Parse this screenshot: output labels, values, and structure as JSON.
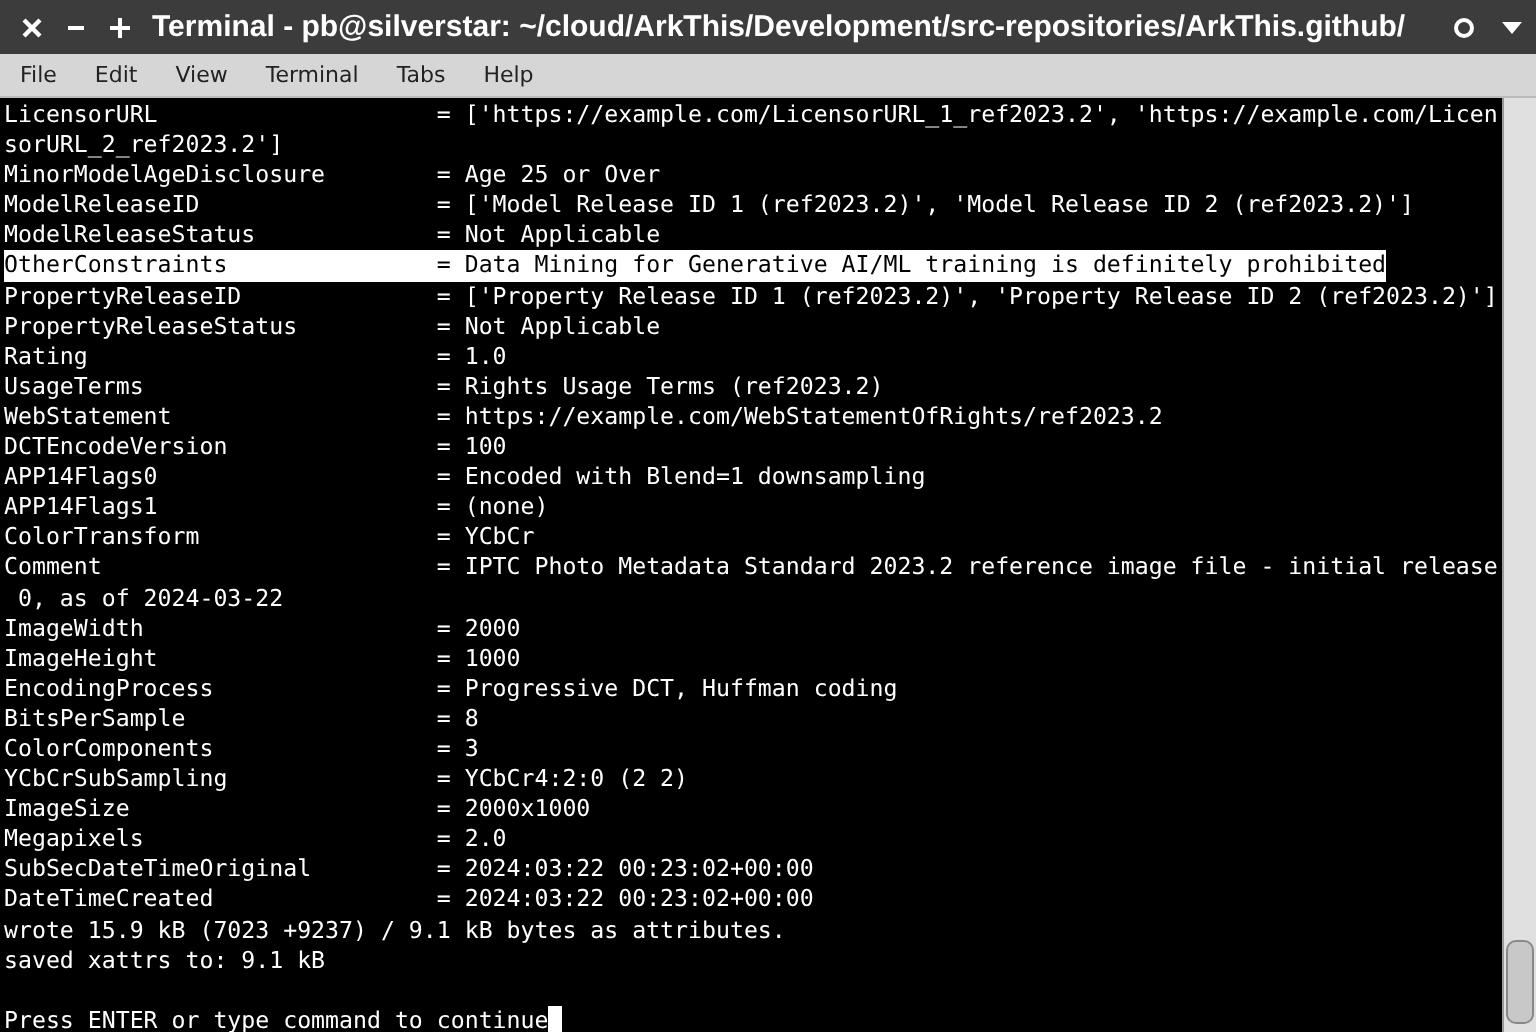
{
  "window": {
    "title": "Terminal - pb@silverstar: ~/cloud/ArkThis/Development/src-repositories/ArkThis.github/"
  },
  "menu": [
    {
      "label": "File"
    },
    {
      "label": "Edit"
    },
    {
      "label": "View"
    },
    {
      "label": "Terminal"
    },
    {
      "label": "Tabs"
    },
    {
      "label": "Help"
    }
  ],
  "terminal": {
    "show_cursor": true,
    "lines": [
      {
        "text": "LicensorURL                    = ['https://example.com/LicensorURL_1_ref2023.2', 'https://example.com/Licen",
        "selected": false
      },
      {
        "text": "sorURL_2_ref2023.2']",
        "selected": false
      },
      {
        "text": "MinorModelAgeDisclosure        = Age 25 or Over",
        "selected": false
      },
      {
        "text": "ModelReleaseID                 = ['Model Release ID 1 (ref2023.2)', 'Model Release ID 2 (ref2023.2)']",
        "selected": false
      },
      {
        "text": "ModelReleaseStatus             = Not Applicable",
        "selected": false
      },
      {
        "text": "OtherConstraints               = Data Mining for Generative AI/ML training is definitely prohibited",
        "selected": true
      },
      {
        "text": "PropertyReleaseID              = ['Property Release ID 1 (ref2023.2)', 'Property Release ID 2 (ref2023.2)']",
        "selected": false
      },
      {
        "text": "PropertyReleaseStatus          = Not Applicable",
        "selected": false
      },
      {
        "text": "Rating                         = 1.0",
        "selected": false
      },
      {
        "text": "UsageTerms                     = Rights Usage Terms (ref2023.2)",
        "selected": false
      },
      {
        "text": "WebStatement                   = https://example.com/WebStatementOfRights/ref2023.2",
        "selected": false
      },
      {
        "text": "DCTEncodeVersion               = 100",
        "selected": false
      },
      {
        "text": "APP14Flags0                    = Encoded with Blend=1 downsampling",
        "selected": false
      },
      {
        "text": "APP14Flags1                    = (none)",
        "selected": false
      },
      {
        "text": "ColorTransform                 = YCbCr",
        "selected": false
      },
      {
        "text": "Comment                        = IPTC Photo Metadata Standard 2023.2 reference image file - initial release",
        "selected": false
      },
      {
        "text": " 0, as of 2024-03-22",
        "selected": false
      },
      {
        "text": "ImageWidth                     = 2000",
        "selected": false
      },
      {
        "text": "ImageHeight                    = 1000",
        "selected": false
      },
      {
        "text": "EncodingProcess                = Progressive DCT, Huffman coding",
        "selected": false
      },
      {
        "text": "BitsPerSample                  = 8",
        "selected": false
      },
      {
        "text": "ColorComponents                = 3",
        "selected": false
      },
      {
        "text": "YCbCrSubSampling               = YCbCr4:2:0 (2 2)",
        "selected": false
      },
      {
        "text": "ImageSize                      = 2000x1000",
        "selected": false
      },
      {
        "text": "Megapixels                     = 2.0",
        "selected": false
      },
      {
        "text": "SubSecDateTimeOriginal         = 2024:03:22 00:23:02+00:00",
        "selected": false
      },
      {
        "text": "DateTimeCreated                = 2024:03:22 00:23:02+00:00",
        "selected": false
      },
      {
        "text": "wrote 15.9 kB (7023 +9237) / 9.1 kB bytes as attributes.",
        "selected": false
      },
      {
        "text": "saved xattrs to: 9.1 kB",
        "selected": false
      },
      {
        "text": "Press ENTER or type command to continue",
        "selected": false
      }
    ]
  }
}
